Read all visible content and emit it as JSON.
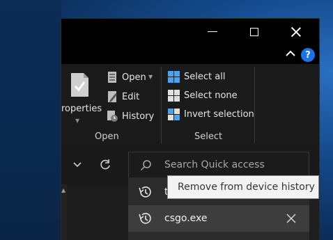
{
  "window": {
    "ribbon": {
      "properties_label": "roperties",
      "open_group": {
        "open_label": "Open",
        "edit_label": "Edit",
        "history_label": "History",
        "group_label": "Open"
      },
      "select_group": {
        "select_all_label": "Select all",
        "select_none_label": "Select none",
        "invert_selection_label": "Invert selection",
        "group_label": "Select"
      }
    },
    "search": {
      "placeholder": "Search Quick access"
    },
    "suggestions": [
      {
        "label": "t"
      },
      {
        "label": "csgo.exe"
      }
    ],
    "tooltip": "Remove from device history"
  },
  "colors": {
    "accent": "#1a73e8",
    "ribbon_bg": "#1a1a1a",
    "titlebar_bg": "#000000",
    "tooltip_bg": "#f3f3f3"
  }
}
